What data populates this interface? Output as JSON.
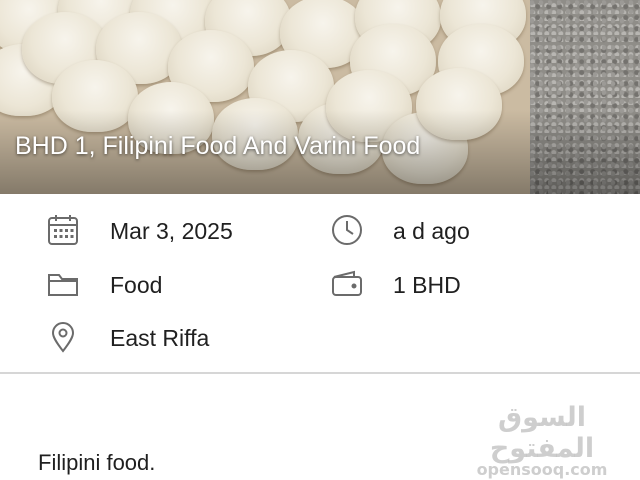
{
  "listing": {
    "title": "BHD 1, Filipini Food And Varini Food",
    "description": "Filipini food."
  },
  "details": {
    "date": "Mar 3, 2025",
    "posted": "a d ago",
    "category": "Food",
    "price": "1 BHD",
    "location": "East Riffa"
  },
  "icons": {
    "date": "calendar-icon",
    "posted": "clock-icon",
    "category": "folder-icon",
    "price": "wallet-icon",
    "location": "location-pin-icon"
  },
  "watermark": {
    "arabic": "السوق المفتوح",
    "latin": "opensooq.com"
  },
  "colors": {
    "icon": "#6b6b6b",
    "divider": "#d6d6d6",
    "text": "#202020"
  }
}
